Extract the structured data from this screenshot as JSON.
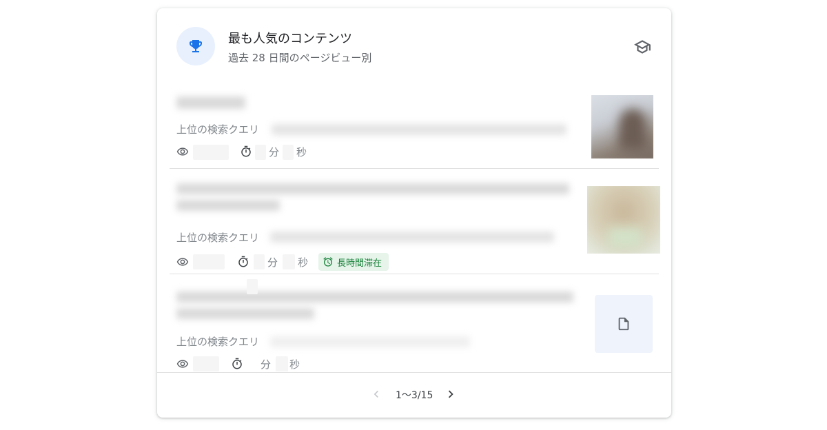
{
  "header": {
    "title": "最も人気のコンテンツ",
    "subtitle": "過去 28 日間のページビュー別",
    "leading_icon": "trophy-icon",
    "action_icon": "school-icon"
  },
  "items": [
    {
      "query_label": "上位の検索クエリ",
      "minute_unit": "分",
      "second_unit": "秒",
      "thumbnail": "image"
    },
    {
      "query_label": "上位の検索クエリ",
      "minute_unit": "分",
      "second_unit": "秒",
      "badge": "長時間滞在",
      "thumbnail": "image"
    },
    {
      "query_label": "上位の検索クエリ",
      "minute_unit": "分",
      "second_unit": "秒",
      "thumbnail": "document-icon"
    }
  ],
  "pagination": {
    "text": "1〜3/15"
  },
  "colors": {
    "accent": "#1a73e8",
    "badge_bg": "#e6f4ea",
    "badge_text": "#188038",
    "muted_text": "#80868b"
  }
}
